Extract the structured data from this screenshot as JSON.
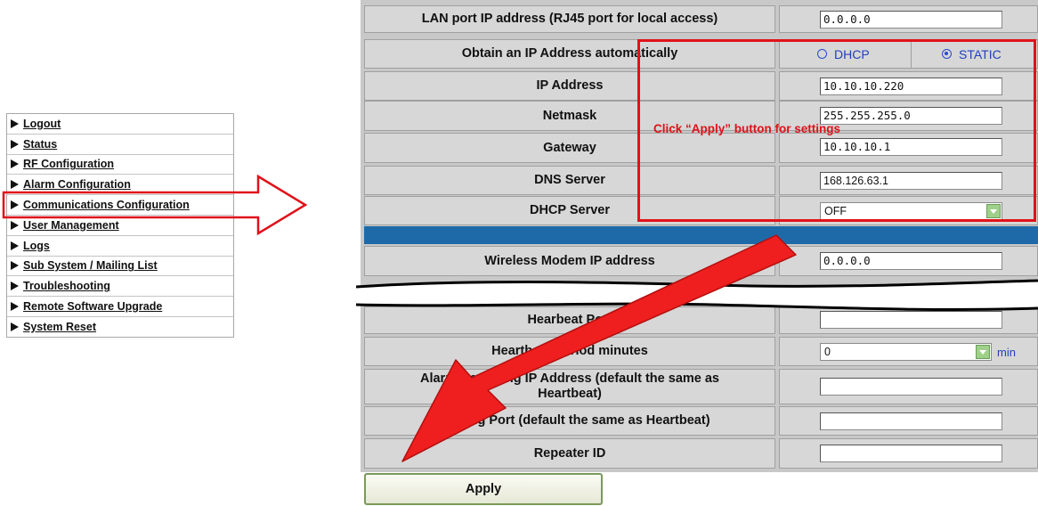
{
  "menu": {
    "items": [
      {
        "label": "Logout"
      },
      {
        "label": "Status"
      },
      {
        "label": "RF Configuration"
      },
      {
        "label": "Alarm Configuration"
      },
      {
        "label": "Communications Configuration"
      },
      {
        "label": "User Management"
      },
      {
        "label": "Logs"
      },
      {
        "label": "Sub System / Mailing List"
      },
      {
        "label": "Troubleshooting"
      },
      {
        "label": "Remote Software Upgrade"
      },
      {
        "label": "System Reset"
      }
    ]
  },
  "form": {
    "lan_ip": {
      "label": "LAN port IP address (RJ45 port for local access)",
      "value": "0.0.0.0"
    },
    "obtain": {
      "label": "Obtain an IP Address automatically",
      "option_dhcp": "DHCP",
      "option_static": "STATIC",
      "selected": "STATIC"
    },
    "ip_address": {
      "label": "IP Address",
      "value": "10.10.10.220"
    },
    "netmask": {
      "label": "Netmask",
      "value": "255.255.255.0"
    },
    "gateway": {
      "label": "Gateway",
      "value": "10.10.10.1"
    },
    "dns": {
      "label": "DNS Server",
      "value": "168.126.63.1"
    },
    "dhcp_server": {
      "label": "DHCP Server",
      "value": "OFF"
    },
    "wireless_modem": {
      "label": "Wireless Modem IP address",
      "value": "0.0.0.0"
    },
    "heartbeat_port": {
      "label": "Hearbeat Port",
      "value": ""
    },
    "heartbeat_period": {
      "label": "Heartbeat Period minutes",
      "value": "0",
      "unit": "min"
    },
    "alarm_ip": {
      "label": "Alarm Reporting IP Address (default the same as Heartbeat)",
      "value": ""
    },
    "alarm_port": {
      "label": "Alarming Port (default the same as Heartbeat)",
      "value": ""
    },
    "repeater_id": {
      "label": "Repeater ID",
      "value": ""
    }
  },
  "apply_label": "Apply",
  "annotation": {
    "text": "Click “Apply” button for settings",
    "color": "#e0121a"
  },
  "colors": {
    "band": "#1e6aa8",
    "radio": "#2a4ac8"
  }
}
